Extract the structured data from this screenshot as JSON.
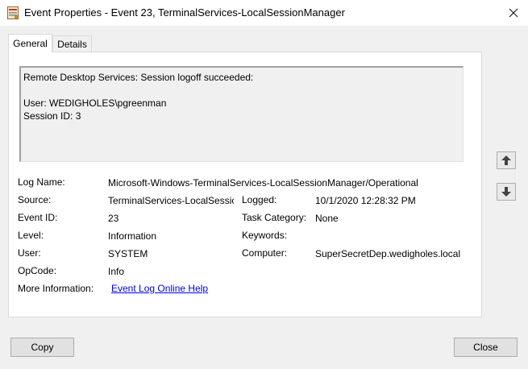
{
  "window": {
    "title": "Event Properties - Event 23, TerminalServices-LocalSessionManager"
  },
  "tabs": [
    {
      "label": "General",
      "active": true
    },
    {
      "label": "Details",
      "active": false
    }
  ],
  "description": {
    "line1": "Remote Desktop Services: Session logoff succeeded:",
    "line2": "",
    "line3": "User: WEDIGHOLES\\pgreenman",
    "line4": "Session ID: 3"
  },
  "fields": {
    "log_name": {
      "label": "Log Name:",
      "value": "Microsoft-Windows-TerminalServices-LocalSessionManager/Operational"
    },
    "source": {
      "label": "Source:",
      "value": "TerminalServices-LocalSessio"
    },
    "logged": {
      "label": "Logged:",
      "value": "10/1/2020 12:28:32 PM"
    },
    "event_id": {
      "label": "Event ID:",
      "value": "23"
    },
    "task_category": {
      "label": "Task Category:",
      "value": "None"
    },
    "level": {
      "label": "Level:",
      "value": "Information"
    },
    "keywords": {
      "label": "Keywords:",
      "value": ""
    },
    "user": {
      "label": "User:",
      "value": "SYSTEM"
    },
    "computer": {
      "label": "Computer:",
      "value": "SuperSecretDep.wedigholes.local"
    },
    "opcode": {
      "label": "OpCode:",
      "value": "Info"
    },
    "more_info": {
      "label": "More Information:",
      "link": "Event Log Online Help"
    }
  },
  "buttons": {
    "copy": "Copy",
    "close": "Close"
  },
  "icons": {
    "app": "event-viewer-icon",
    "close": "close-icon",
    "up": "arrow-up-icon",
    "down": "arrow-down-icon"
  }
}
